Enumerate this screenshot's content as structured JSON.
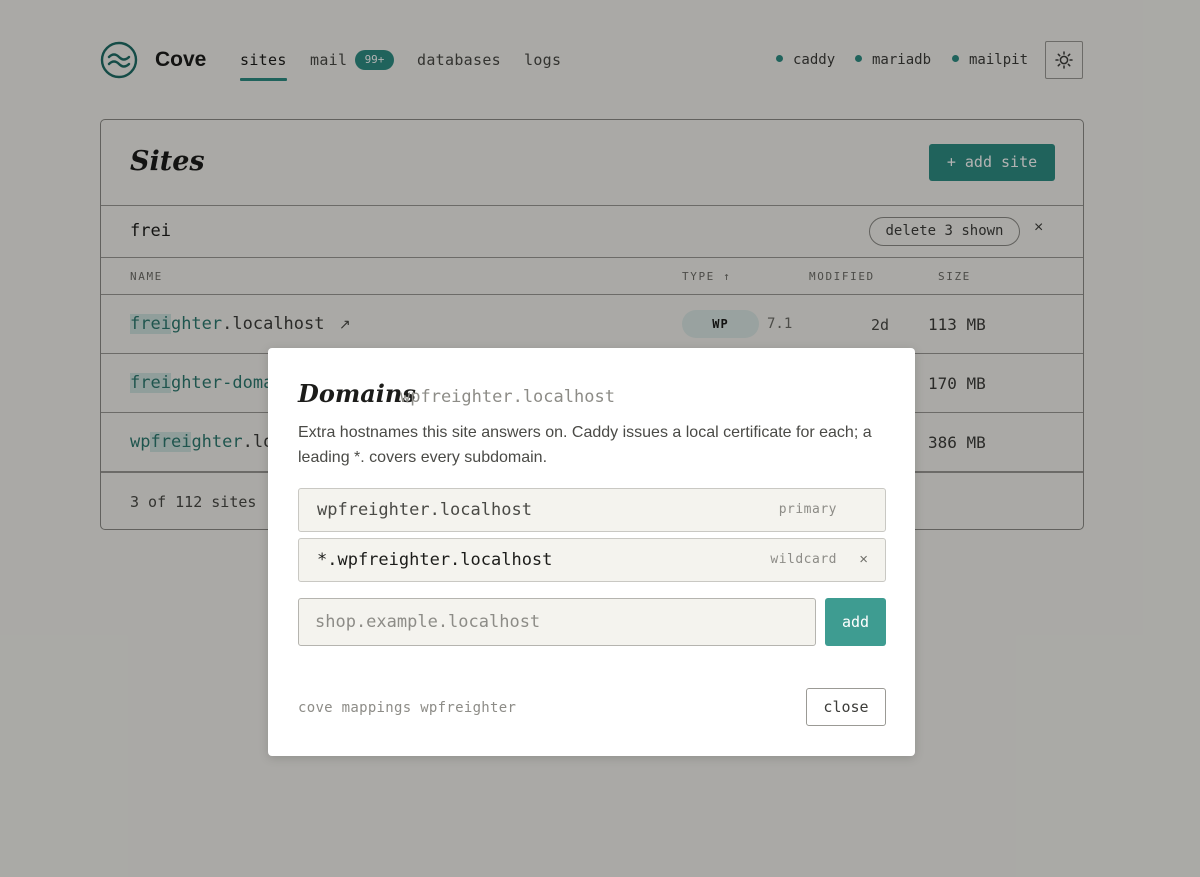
{
  "app": {
    "name": "Cove"
  },
  "nav": {
    "sites": "sites",
    "mail": "mail",
    "mail_badge": "99+",
    "databases": "databases",
    "logs": "logs"
  },
  "services": [
    "caddy",
    "mariadb",
    "mailpit"
  ],
  "icons": {
    "logo": "waves-logo-icon",
    "theme": "sun-icon",
    "external": "arrow-up-right-icon",
    "sort": "arrow-up-icon"
  },
  "colors": {
    "accent": "#2f8f84",
    "highlight": "#cfe3df"
  },
  "sites": {
    "title": "Sites",
    "add_button": "+ add site",
    "filter": "frei",
    "delete_shown": "delete 3 shown",
    "clear_filter": "×",
    "columns": {
      "name": "NAME",
      "type": "TYPE",
      "sort_arrow": "↑",
      "modified": "MODIFIED",
      "size": "SIZE"
    },
    "rows": [
      {
        "pre": "",
        "match": "frei",
        "post": "ghter",
        "suffix": ".localhost",
        "ext": "↗",
        "type": "WP",
        "version": "7.1",
        "modified": "2d",
        "size": "113 MB"
      },
      {
        "pre": "",
        "match": "frei",
        "post": "ghter-doma",
        "suffix": "",
        "size": "170 MB"
      },
      {
        "pre": "wp",
        "match": "frei",
        "post": "ghter",
        "suffix": ".lo",
        "size": "386 MB"
      }
    ],
    "count": "3 of 112 sites"
  },
  "modal": {
    "title": "Domains",
    "host": "wpfreighter.localhost",
    "description": "Extra hostnames this site answers on. Caddy issues a local certificate for each; a leading *. covers every subdomain.",
    "domains": [
      {
        "host": "wpfreighter.localhost",
        "tag": "primary"
      },
      {
        "host": "*.wpfreighter.localhost",
        "tag": "wildcard",
        "remove": "×"
      }
    ],
    "new_placeholder": "shop.example.localhost",
    "add_button": "add",
    "cli_hint": "cove mappings wpfreighter",
    "close_button": "close"
  }
}
